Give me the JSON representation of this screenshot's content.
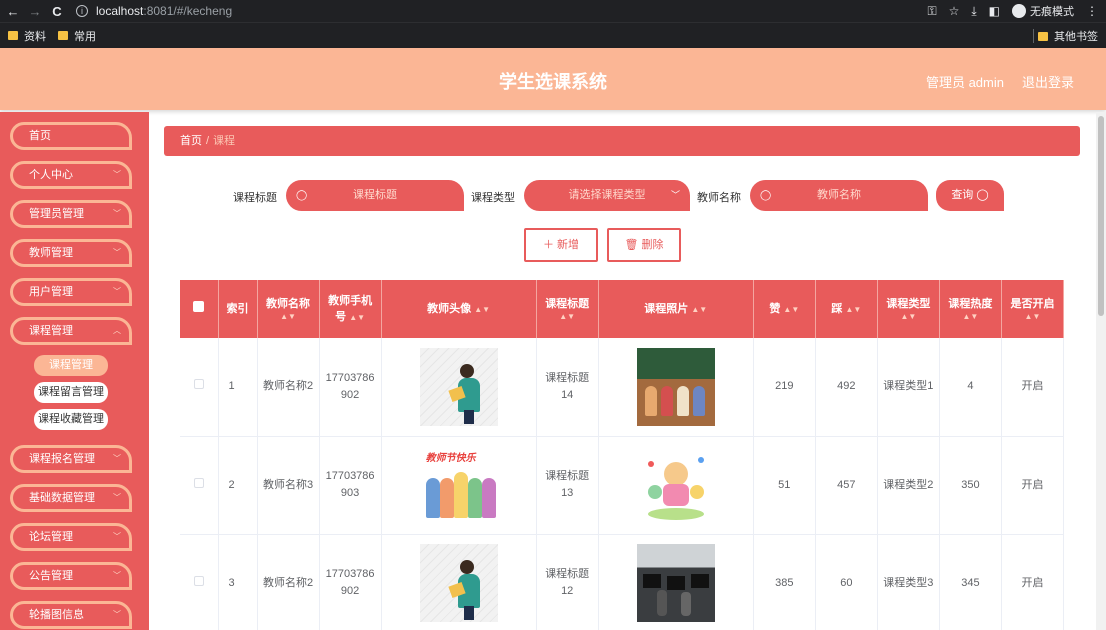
{
  "browser": {
    "back": "←",
    "forward": "→",
    "reload": "C",
    "url_host": "localhost",
    "url_path": ":8081/#/kecheng",
    "incognito": "无痕模式",
    "bookmarks": [
      "资料",
      "常用"
    ],
    "other_bookmarks": "其他书签"
  },
  "header": {
    "title": "学生选课系统",
    "admin": "管理员 admin",
    "logout": "退出登录"
  },
  "sidebar": {
    "items": [
      {
        "label": "首页"
      },
      {
        "label": "个人中心"
      },
      {
        "label": "管理员管理"
      },
      {
        "label": "教师管理"
      },
      {
        "label": "用户管理"
      },
      {
        "label": "课程管理"
      },
      {
        "label": "课程报名管理"
      },
      {
        "label": "基础数据管理"
      },
      {
        "label": "论坛管理"
      },
      {
        "label": "公告管理"
      },
      {
        "label": "轮播图信息"
      }
    ],
    "sub_items": [
      "课程管理",
      "课程留言管理",
      "课程收藏管理"
    ]
  },
  "breadcrumb": {
    "home": "首页",
    "sep": "/",
    "current": "课程"
  },
  "filters": {
    "title_label": "课程标题",
    "title_placeholder": "课程标题",
    "type_label": "课程类型",
    "type_placeholder": "请选择课程类型",
    "teacher_label": "教师名称",
    "teacher_placeholder": "教师名称",
    "query": "查询"
  },
  "actions": {
    "add": "新增",
    "delete": "删除"
  },
  "table": {
    "headers": [
      "索引",
      "教师名称",
      "教师手机号",
      "教师头像",
      "课程标题",
      "课程照片",
      "赞",
      "踩",
      "课程类型",
      "课程热度",
      "是否开启"
    ],
    "rows": [
      {
        "index": "1",
        "teacher": "教师名称2",
        "phone": "17703786902",
        "title": "课程标题14",
        "likes": "219",
        "dislikes": "492",
        "type": "课程类型1",
        "heat": "4",
        "open": "开启"
      },
      {
        "index": "2",
        "teacher": "教师名称3",
        "phone": "17703786903",
        "title": "课程标题13",
        "likes": "51",
        "dislikes": "457",
        "type": "课程类型2",
        "heat": "350",
        "open": "开启"
      },
      {
        "index": "3",
        "teacher": "教师名称2",
        "phone": "17703786902",
        "title": "课程标题12",
        "likes": "385",
        "dislikes": "60",
        "type": "课程类型3",
        "heat": "345",
        "open": "开启"
      }
    ],
    "banner_text": "教师节快乐"
  },
  "colors": {
    "primary": "#e85b5b",
    "accent": "#fbb695"
  }
}
